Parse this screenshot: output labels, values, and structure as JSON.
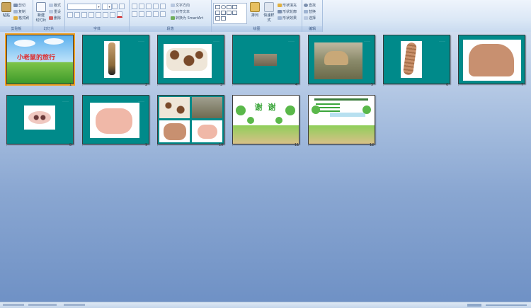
{
  "ribbon": {
    "clipboard": {
      "label": "剪贴板",
      "paste": "粘贴",
      "cut": "剪切",
      "copy": "复制",
      "format_painter": "格式刷"
    },
    "slides": {
      "label": "幻灯片",
      "new_slide": "新建\n幻灯片",
      "layout": "版式",
      "reset": "重设",
      "delete": "删除"
    },
    "font": {
      "label": "字体"
    },
    "paragraph": {
      "label": "段落",
      "text_direction": "文字方向",
      "align_text": "对齐文本",
      "smartart": "转换为 SmartArt"
    },
    "drawing": {
      "label": "绘图",
      "arrange": "排列",
      "quick_styles": "快速样式",
      "shape_fill": "形状填充",
      "shape_outline": "形状轮廓",
      "shape_effects": "形状效果"
    },
    "editing": {
      "label": "编辑",
      "find": "查找",
      "replace": "替换",
      "select": "选择"
    }
  },
  "slides": [
    {
      "num": "1",
      "title": "小老鼠的旅行"
    },
    {
      "num": "2",
      "title": ""
    },
    {
      "num": "3",
      "title": ""
    },
    {
      "num": "4",
      "title": ""
    },
    {
      "num": "5",
      "title": ""
    },
    {
      "num": "6",
      "title": ""
    },
    {
      "num": "7",
      "title": ""
    },
    {
      "num": "8",
      "title": ""
    },
    {
      "num": "9",
      "title": ""
    },
    {
      "num": "10",
      "title": ""
    },
    {
      "num": "11",
      "title": "谢 谢"
    },
    {
      "num": "12",
      "title": ""
    }
  ],
  "colors": {
    "slide_bg": "#008a8a",
    "selected": "#f0a020",
    "ribbon": "#dce8f6",
    "workspace": "#89a6d1"
  }
}
